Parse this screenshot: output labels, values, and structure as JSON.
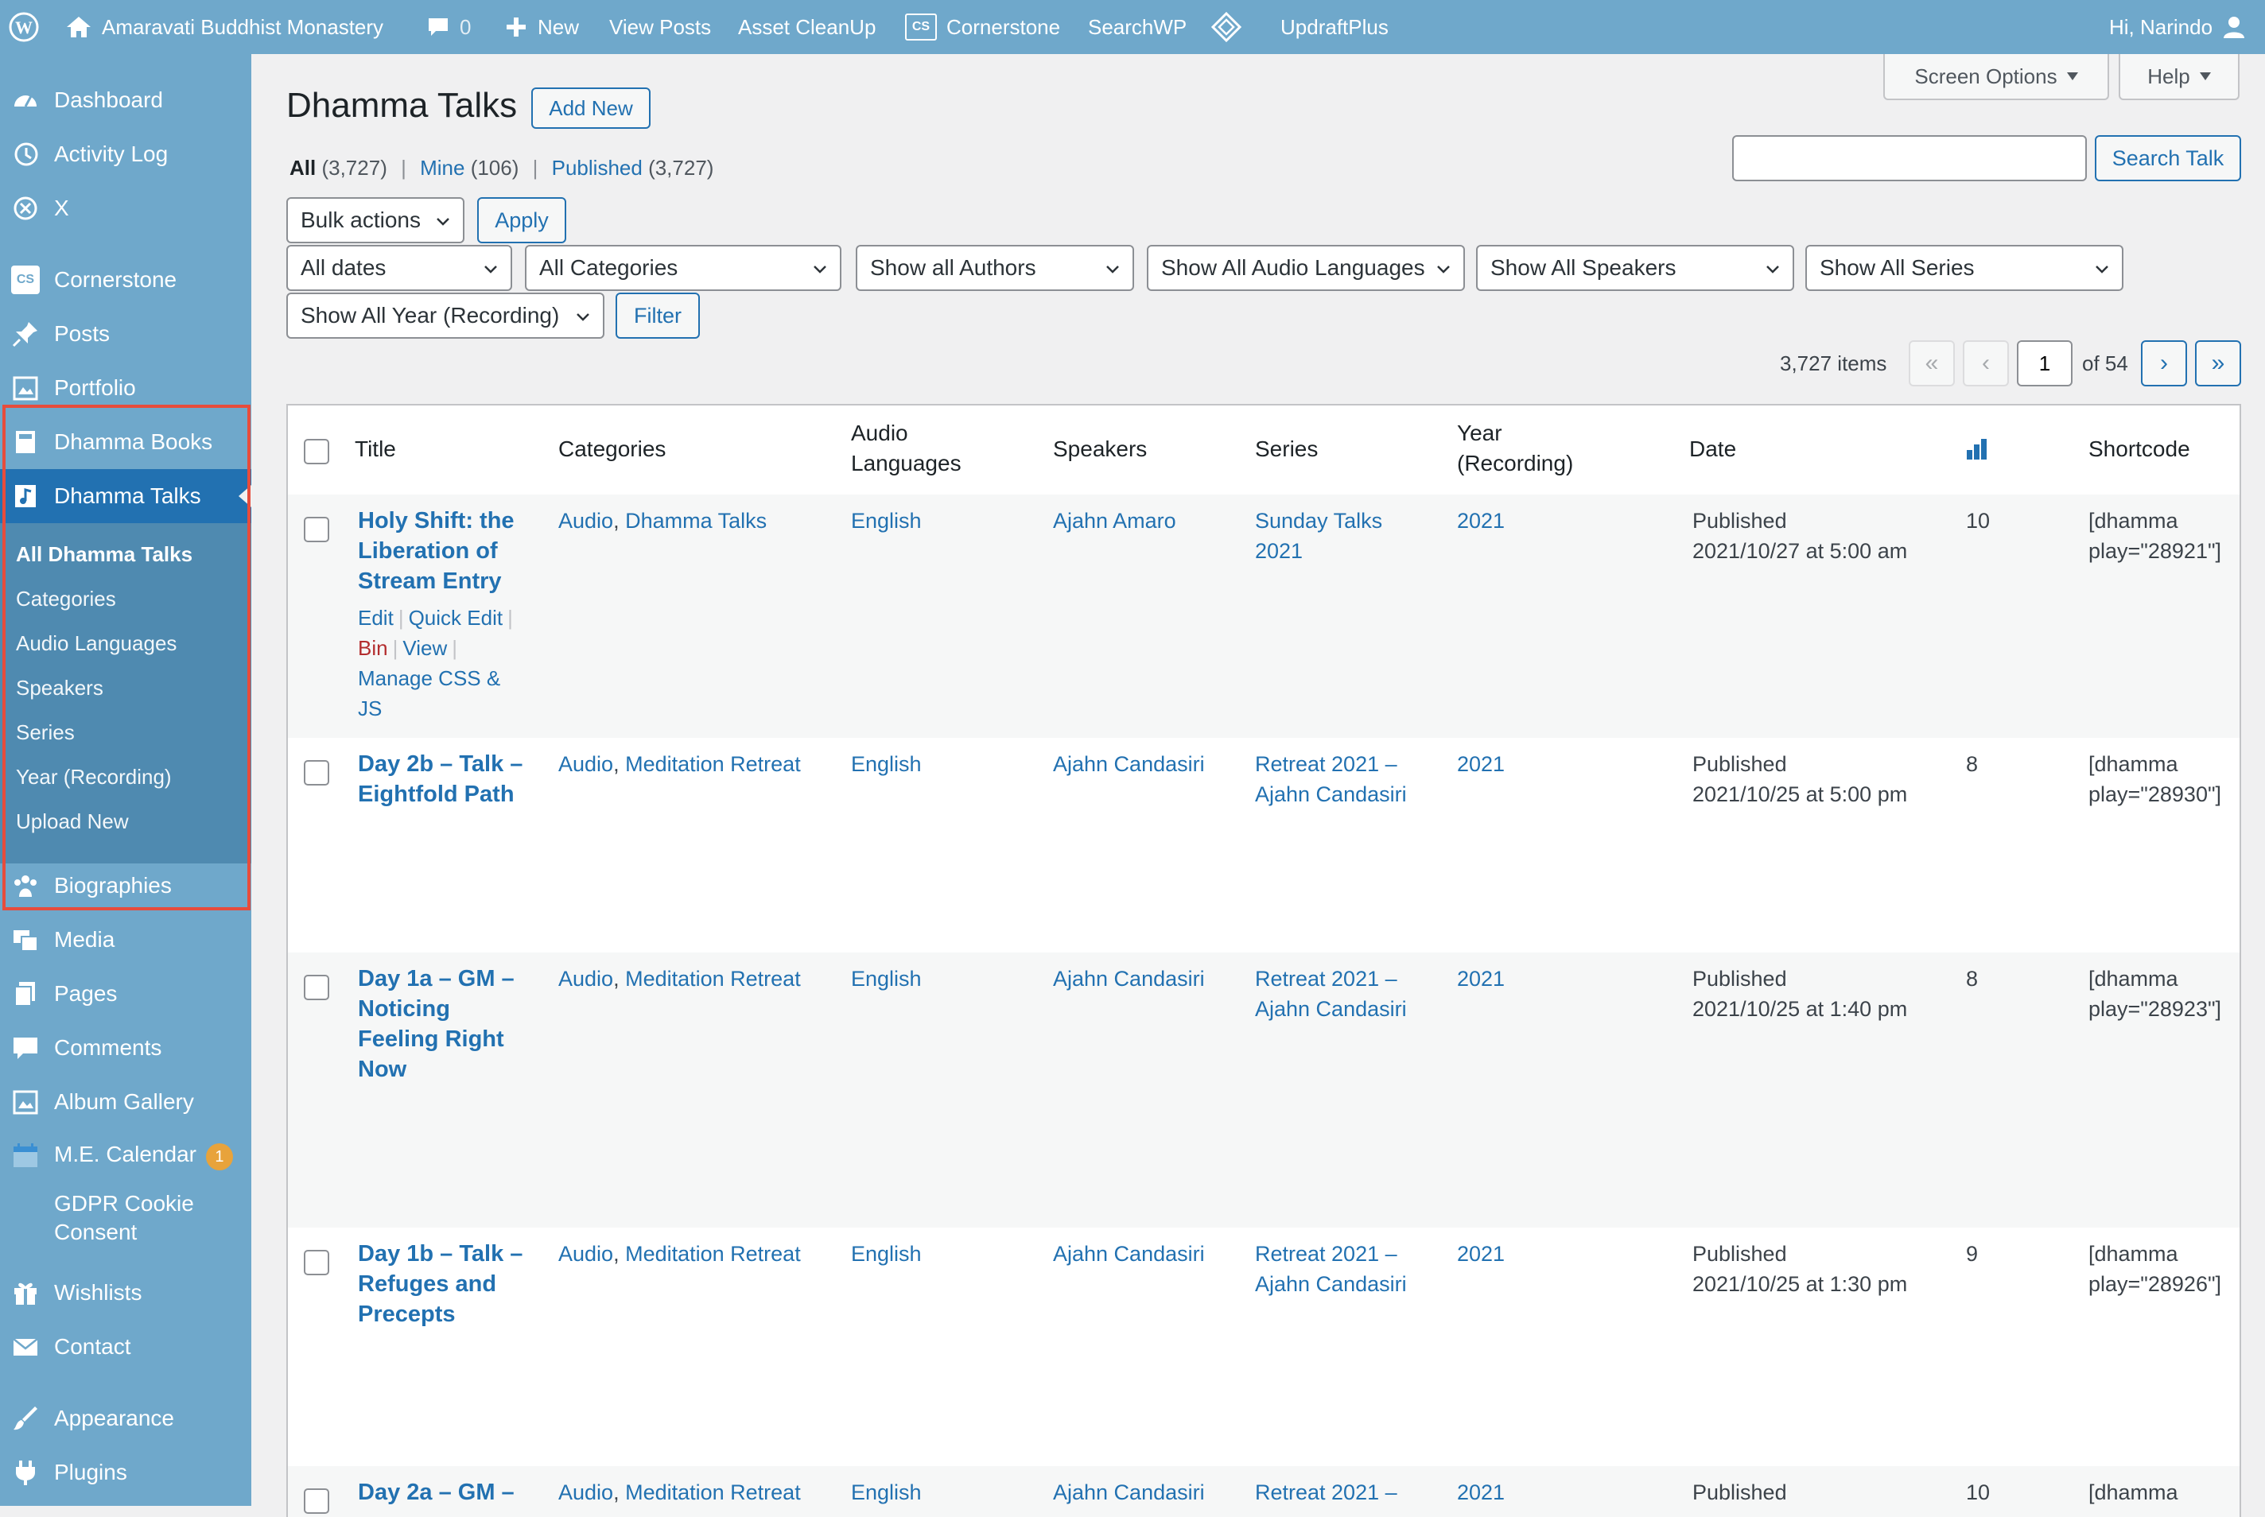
{
  "admin_bar": {
    "site_name": "Amaravati Buddhist Monastery",
    "comments_count": "0",
    "new_label": "New",
    "view_posts": "View Posts",
    "asset_cleanup": "Asset CleanUp",
    "cornerstone": "Cornerstone",
    "searchwp": "SearchWP",
    "updraftplus": "UpdraftPlus",
    "greeting": "Hi, Narindo"
  },
  "sidebar": {
    "items": [
      {
        "label": "Dashboard",
        "icon": "dashboard-icon"
      },
      {
        "label": "Activity Log",
        "icon": "history-icon"
      },
      {
        "label": "X",
        "icon": "circle-x-icon"
      },
      {
        "label": "Cornerstone",
        "icon": "cs-icon"
      },
      {
        "label": "Posts",
        "icon": "pin-icon"
      },
      {
        "label": "Portfolio",
        "icon": "portfolio-icon"
      },
      {
        "label": "Dhamma Books",
        "icon": "book-icon"
      },
      {
        "label": "Dhamma Talks",
        "icon": "audio-icon"
      },
      {
        "label": "Biographies",
        "icon": "users-icon"
      },
      {
        "label": "Media",
        "icon": "media-icon"
      },
      {
        "label": "Pages",
        "icon": "pages-icon"
      },
      {
        "label": "Comments",
        "icon": "comment-icon"
      },
      {
        "label": "Album Gallery",
        "icon": "gallery-icon"
      },
      {
        "label": "M.E. Calendar",
        "icon": "calendar-icon",
        "badge": "1"
      },
      {
        "label": "GDPR Cookie Consent",
        "icon": ""
      },
      {
        "label": "Wishlists",
        "icon": "gift-icon"
      },
      {
        "label": "Contact",
        "icon": "mail-icon"
      },
      {
        "label": "Appearance",
        "icon": "brush-icon"
      },
      {
        "label": "Plugins",
        "icon": "plugin-icon"
      }
    ],
    "submenu": [
      "All Dhamma Talks",
      "Categories",
      "Audio Languages",
      "Speakers",
      "Series",
      "Year (Recording)",
      "Upload New"
    ],
    "gdpr_line1": "GDPR Cookie",
    "gdpr_line2": "Consent"
  },
  "header": {
    "screen_options": "Screen Options",
    "help": "Help",
    "page_title": "Dhamma Talks",
    "add_new": "Add New"
  },
  "views": {
    "all_label": "All",
    "all_count": "(3,727)",
    "mine_label": "Mine",
    "mine_count": "(106)",
    "published_label": "Published",
    "published_count": "(3,727)"
  },
  "search": {
    "value": "",
    "button": "Search Talk"
  },
  "filters": {
    "bulk_actions": "Bulk actions",
    "apply": "Apply",
    "dates": "All dates",
    "categories": "All Categories",
    "authors": "Show all Authors",
    "audio_languages": "Show All Audio Languages",
    "speakers": "Show All Speakers",
    "series": "Show All Series",
    "year": "Show All Year (Recording)",
    "filter_button": "Filter"
  },
  "pagination": {
    "items": "3,727 items",
    "first": "«",
    "prev": "‹",
    "current": "1",
    "of": "of 54",
    "next": "›",
    "last": "»"
  },
  "columns": {
    "title": "Title",
    "categories": "Categories",
    "audio_lang_1": "Audio",
    "audio_lang_2": "Languages",
    "speakers": "Speakers",
    "series": "Series",
    "year_1": "Year",
    "year_2": "(Recording)",
    "date": "Date",
    "shortcode": "Shortcode"
  },
  "row_actions": {
    "edit": "Edit",
    "quick_edit": "Quick Edit",
    "bin": "Bin",
    "view": "View",
    "manage_css_1": "Manage CSS &",
    "manage_css_2": "JS"
  },
  "rows": [
    {
      "title_lines": [
        "Holy Shift: the",
        "Liberation of",
        "Stream Entry"
      ],
      "cat1": "Audio",
      "cat2": "Dhamma Talks",
      "language": "English",
      "speaker": "Ajahn Amaro",
      "series_lines": [
        "Sunday Talks",
        "2021"
      ],
      "year": "2021",
      "status": "Published",
      "date": "2021/10/27 at 5:00 am",
      "plays": "10",
      "short1": "[dhamma",
      "short2": "play=\"28921\"]"
    },
    {
      "title_lines": [
        "Day 2b – Talk –",
        "Eightfold Path"
      ],
      "cat1": "Audio",
      "cat2": "Meditation Retreat",
      "language": "English",
      "speaker": "Ajahn Candasiri",
      "series_lines": [
        "Retreat 2021 –",
        "Ajahn Candasiri"
      ],
      "year": "2021",
      "status": "Published",
      "date": "2021/10/25 at 5:00 pm",
      "plays": "8",
      "short1": "[dhamma",
      "short2": "play=\"28930\"]"
    },
    {
      "title_lines": [
        "Day 1a – GM –",
        "Noticing",
        "Feeling Right",
        "Now"
      ],
      "cat1": "Audio",
      "cat2": "Meditation Retreat",
      "language": "English",
      "speaker": "Ajahn Candasiri",
      "series_lines": [
        "Retreat 2021 –",
        "Ajahn Candasiri"
      ],
      "year": "2021",
      "status": "Published",
      "date": "2021/10/25 at 1:40 pm",
      "plays": "8",
      "short1": "[dhamma",
      "short2": "play=\"28923\"]"
    },
    {
      "title_lines": [
        "Day 1b – Talk –",
        "Refuges and",
        "Precepts"
      ],
      "cat1": "Audio",
      "cat2": "Meditation Retreat",
      "language": "English",
      "speaker": "Ajahn Candasiri",
      "series_lines": [
        "Retreat 2021 –",
        "Ajahn Candasiri"
      ],
      "year": "2021",
      "status": "Published",
      "date": "2021/10/25 at 1:30 pm",
      "plays": "9",
      "short1": "[dhamma",
      "short2": "play=\"28926\"]"
    },
    {
      "title_lines": [
        "Day 2a – GM –"
      ],
      "cat1": "Audio",
      "cat2": "Meditation Retreat",
      "language": "English",
      "speaker": "Ajahn Candasiri",
      "series_lines": [
        "Retreat 2021 –"
      ],
      "year": "2021",
      "status": "Published",
      "date": "",
      "plays": "10",
      "short1": "[dhamma",
      "short2": ""
    }
  ]
}
